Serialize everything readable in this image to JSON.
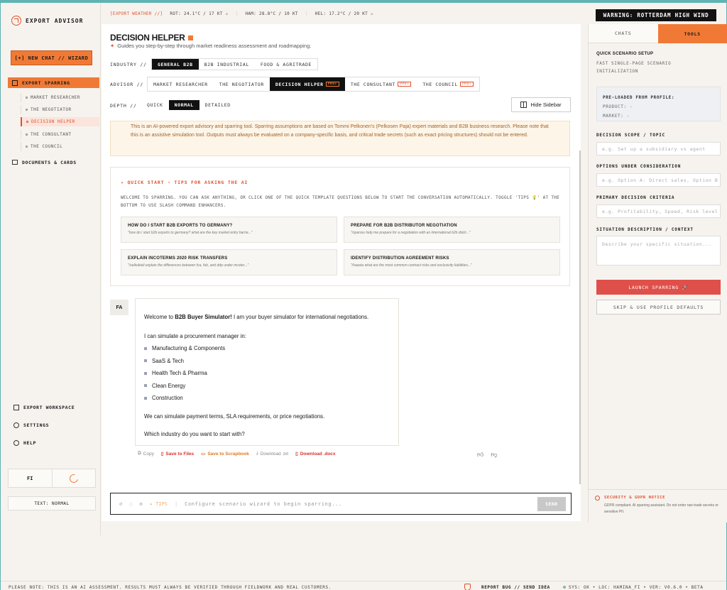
{
  "app": {
    "title": "EXPORT ADVISOR"
  },
  "sidebar": {
    "new_chat": "[+] NEW CHAT // WIZARD",
    "export_sparring": "EXPORT SPARRING",
    "sub_items": [
      "MARKET RESEARCHER",
      "THE NEGOTIATOR",
      "DECISION HELPER",
      "THE CONSULTANT",
      "THE COUNCIL"
    ],
    "documents": "DOCUMENTS & CARDS",
    "workspace": "EXPORT WORKSPACE",
    "settings": "SETTINGS",
    "help": "HELP",
    "lang": "FI",
    "text_size": "TEXT: NORMAL"
  },
  "weather": {
    "label": "[EXPORT WEATHER //]",
    "rot": "ROT: 24.1°C / 17 KT ⚠",
    "ham": "HAM: 28.8°C / 10 KT",
    "hel": "HEL: 17.2°C / 20 KT ⚠"
  },
  "warning": "WARNING: ROTTERDAM HIGH WIND",
  "main": {
    "title": "DECISION HELPER",
    "subtitle": "Guides you step-by-step through market readiness assessment and roadmapping.",
    "industry_label": "INDUSTRY //",
    "industries": [
      "GENERAL B2B",
      "B2B INDUSTRIAL",
      "FOOD & AGRITRADE"
    ],
    "advisor_label": "ADVISOR //",
    "advisors": [
      "MARKET RESEARCHER",
      "THE NEGOTIATOR",
      "DECISION HELPER",
      "THE CONSULTANT",
      "THE COUNCIL"
    ],
    "pro_badge": "PRO+",
    "depth_label": "DEPTH //",
    "depths": [
      "QUICK",
      "NORMAL",
      "DETAILED"
    ],
    "hide_sidebar": "Hide Sidebar",
    "disclaimer": "This is an AI-powered export advisory and sparring tool. Sparring assumptions are based on Tommi Pelkonen's (Pelkosen Paja) expert materials and B2B business research. Please note that this is an assistive simulation tool. Outputs must always be evaluated on a company-specific basis, and critical trade secrets (such as exact pricing structures) should not be entered.",
    "tips_title": "QUICK START - TIPS FOR ASKING THE AI",
    "tips_desc": "WELCOME TO SPARRING. YOU CAN ASK ANYTHING, OR CLICK ONE OF THE QUICK TEMPLATE QUESTIONS BELOW TO START THE CONVERSATION AUTOMATICALLY. TOGGLE 'TIPS 💡' AT THE BOTTOM TO USE SLASH COMMAND ENHANCERS.",
    "cards": [
      {
        "title": "HOW DO I START B2B EXPORTS TO GERMANY?",
        "sub": "\"how do i start b2b exports to germany? what are the key market entry barrie...\""
      },
      {
        "title": "PREPARE FOR B2B DISTRIBUTOR NEGOTIATION",
        "sub": "\"/sparras help me prepare for a negotiation with an international b2b distri...\""
      },
      {
        "title": "EXPLAIN INCOTERMS 2020 RISK TRANSFERS",
        "sub": "\"/selkokieli explain the differences between fca, fob, and ddp under incoter...\""
      },
      {
        "title": "IDENTIFY DISTRIBUTION AGREEMENT RISKS",
        "sub": "\"/haasta what are the most common contract risks and exclusivity liabilities...\""
      }
    ],
    "avatar": "FA",
    "msg_intro_pre": "Welcome to ",
    "msg_intro_bold": "B2B Buyer Simulator!",
    "msg_intro_post": " I am your buyer simulator for international negotiations.",
    "msg_can": "I can simulate a procurement manager in:",
    "msg_list": [
      "Manufacturing & Components",
      "SaaS & Tech",
      "Health Tech & Pharma",
      "Clean Energy",
      "Construction"
    ],
    "msg_simulate": "We can simulate payment terms, SLA requirements, or price negotiations.",
    "msg_question": "Which industry do you want to start with?",
    "actions": {
      "copy": "Copy",
      "save_files": "Save to Files",
      "save_scrap": "Save to Scrapbook",
      "download_txt": "Download .txt",
      "download_docx": "Download .docx"
    },
    "input_tips": "TIPS",
    "input_placeholder": "Configure scenario wizard to begin sparring...",
    "send": "SEND"
  },
  "right": {
    "tab_chats": "CHATS",
    "tab_tools": "TOOLS",
    "qs_title": "QUICK SCENARIO SETUP",
    "qs_sub": "FAST SINGLE-PAGE SCENARIO INITIALIZATION",
    "preload_title": "PRE-LOADED FROM PROFILE:",
    "product": "PRODUCT: -",
    "market": "MARKET: -",
    "scope_label": "DECISION SCOPE / TOPIC",
    "scope_ph": "e.g. Set up a subsidiary vs agent",
    "options_label": "OPTIONS UNDER CONSIDERATION",
    "options_ph": "e.g. Option A: Direct sales, Option B",
    "criteria_label": "PRIMARY DECISION CRITERIA",
    "criteria_ph": "e.g. Profitability, Speed, Risk level",
    "situation_label": "SITUATION DESCRIPTION / CONTEXT",
    "situation_ph": "Describe your specific situation...",
    "launch": "LAUNCH SPARRING 🚀",
    "skip": "SKIP & USE PROFILE DEFAULTS",
    "gdpr_title": "SECURITY & GDPR NOTICE",
    "gdpr_text": "GDPR compliant. AI sparring assistant. Do not enter raw trade secrets or sensitive PII."
  },
  "footer": {
    "note": "PLEASE NOTE: THIS IS AN AI ASSESSMENT. RESULTS MUST ALWAYS BE VERIFIED THROUGH FIELDWORK AND REAL CUSTOMERS.",
    "report": "REPORT BUG // SEND IDEA",
    "status": "SYS: OK • LOC: HAMINA_FI • VER: V0.6.0 • BETA"
  }
}
